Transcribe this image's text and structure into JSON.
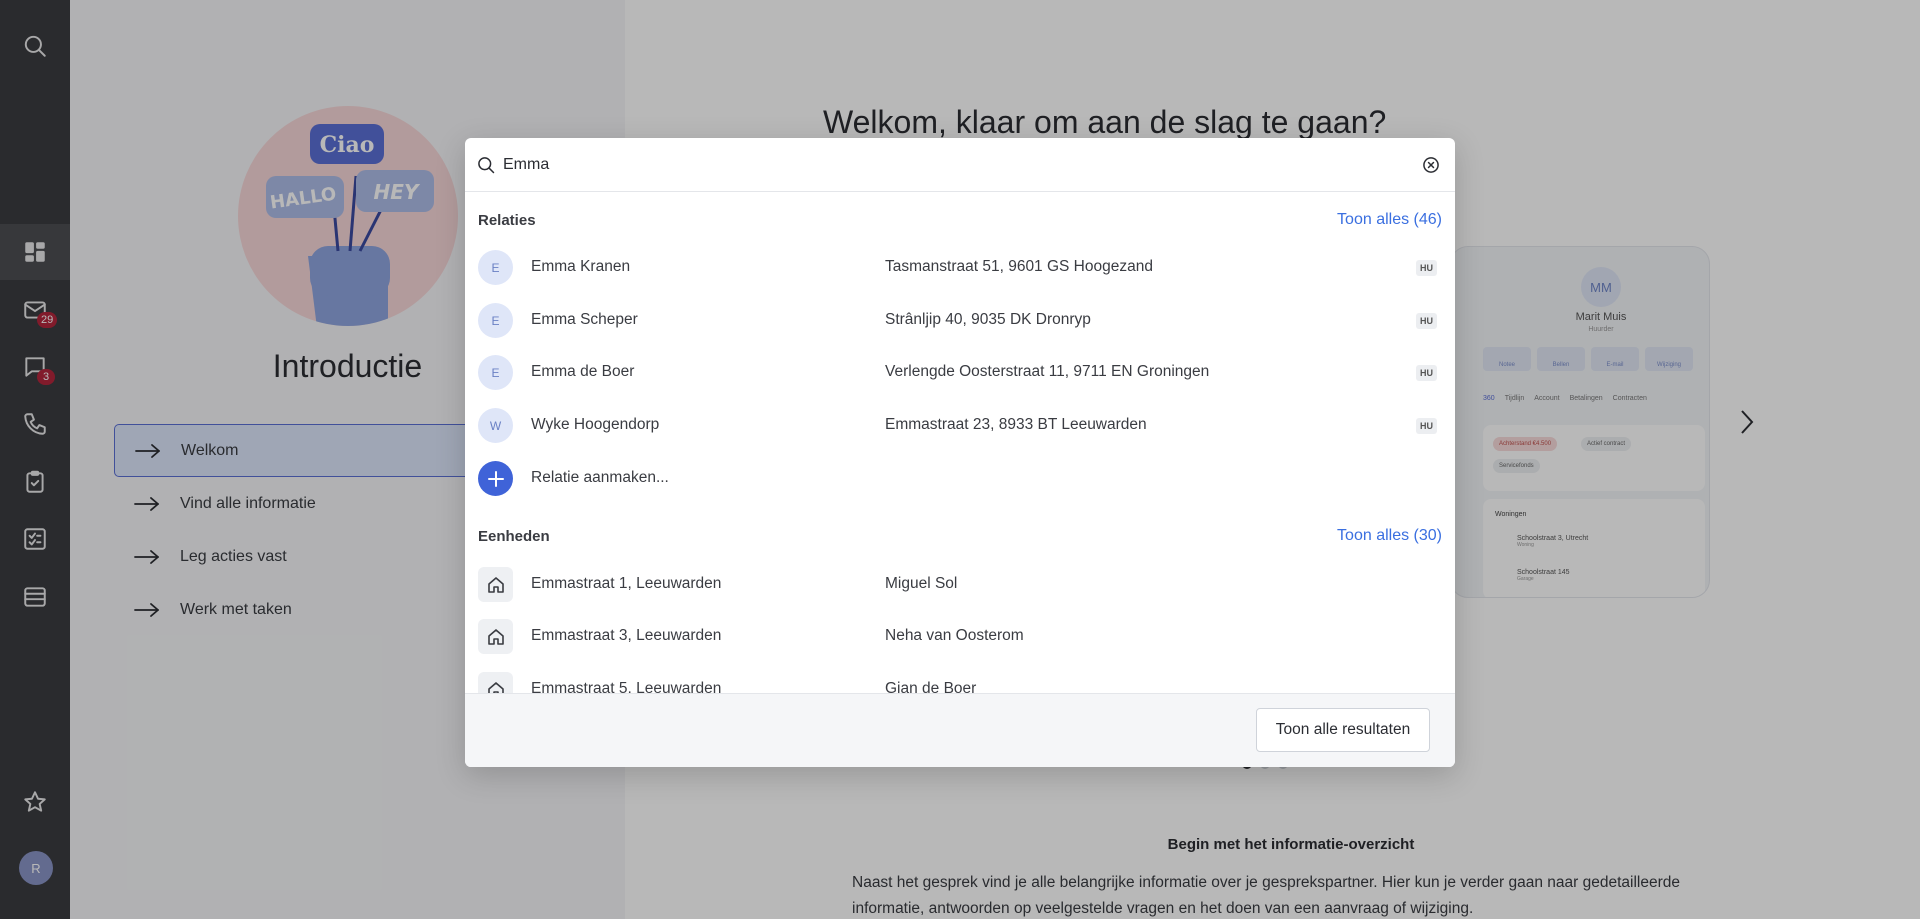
{
  "rail": {
    "items": [
      {
        "icon": "search-icon"
      },
      {
        "icon": "dashboard-icon"
      },
      {
        "icon": "mail-icon",
        "badge": "29"
      },
      {
        "icon": "chat-icon",
        "badge": "3"
      },
      {
        "icon": "phone-icon"
      },
      {
        "icon": "clipboard-check-icon"
      },
      {
        "icon": "checklist-icon"
      },
      {
        "icon": "inbox-icon"
      },
      {
        "icon": "star-icon"
      }
    ],
    "avatar_initial": "R"
  },
  "intro": {
    "illustration_words": [
      "Ciao",
      "HALLO",
      "HEY"
    ],
    "title": "Introductie",
    "steps": [
      "Welkom",
      "Vind alle informatie",
      "Leg acties vast",
      "Werk met taken"
    ]
  },
  "main": {
    "welcome": "Welkom, klaar om aan de slag te gaan?",
    "preview": {
      "initials": "MM",
      "name": "Marit Muis",
      "role": "Huurder",
      "actions": [
        "Notee",
        "Bellen",
        "E-mail",
        "Wijziging"
      ],
      "tabs": [
        "360",
        "Tijdlijn",
        "Account",
        "Betalingen",
        "Contracten"
      ],
      "chips": [
        "Achterstand €4.500",
        "Actief contract",
        "Servicefonds"
      ],
      "homes_title": "Woningen",
      "homes": [
        {
          "address": "Schoolstraat 3, Utrecht",
          "type": "Woning"
        },
        {
          "address": "Schoolstraat 145",
          "type": "Garage"
        }
      ]
    },
    "section_title": "Begin met het informatie-overzicht",
    "section_text": "Naast het gesprek vind je alle belangrijke informatie over je gesprekspartner. Hier kun je verder gaan naar gedetailleerde informatie, antwoorden op veelgestelde vragen en het doen van een aanvraag of wijziging."
  },
  "search": {
    "query": "Emma",
    "groups": {
      "relaties": {
        "title": "Relaties",
        "show_all": "Toon alles (46)",
        "items": [
          {
            "initial": "E",
            "name": "Emma Kranen",
            "address": "Tasmanstraat 51, 9601 GS Hoogezand",
            "tag": "HU"
          },
          {
            "initial": "E",
            "name": "Emma Scheper",
            "address": "Strânljip 40, 9035 DK Dronryp",
            "tag": "HU"
          },
          {
            "initial": "E",
            "name": "Emma de Boer",
            "address": "Verlengde Oosterstraat 11, 9711 EN Groningen",
            "tag": "HU"
          },
          {
            "initial": "W",
            "name": "Wyke Hoogendorp",
            "address": "Emmastraat 23, 8933 BT Leeuwarden",
            "tag": "HU"
          }
        ],
        "create_label": "Relatie aanmaken..."
      },
      "eenheden": {
        "title": "Eenheden",
        "show_all": "Toon alles (30)",
        "items": [
          {
            "name": "Emmastraat 1, Leeuwarden",
            "owner": "Miguel Sol"
          },
          {
            "name": "Emmastraat 3, Leeuwarden",
            "owner": "Neha van Oosterom"
          },
          {
            "name": "Emmastraat 5, Leeuwarden",
            "owner": "Gian de Boer"
          }
        ]
      }
    },
    "footer_button": "Toon alle resultaten"
  }
}
